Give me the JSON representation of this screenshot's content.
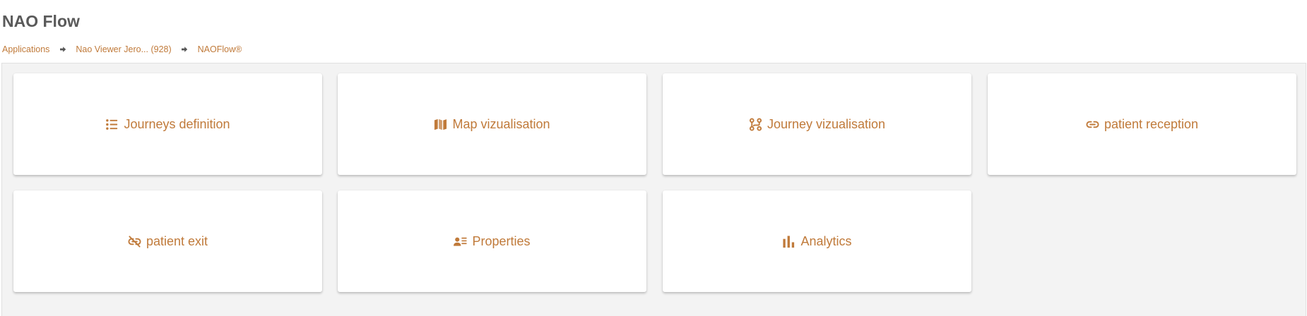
{
  "page": {
    "title": "NAO Flow"
  },
  "breadcrumb": {
    "items": [
      {
        "label": "Applications"
      },
      {
        "label": "Nao Viewer Jero... (928)"
      },
      {
        "label": "NAOFlow®"
      }
    ],
    "separator_icon": "arrow-right-icon"
  },
  "tiles": [
    {
      "label": "Journeys definition",
      "icon": "list-icon"
    },
    {
      "label": "Map vizualisation",
      "icon": "map-icon"
    },
    {
      "label": "Journey vizualisation",
      "icon": "route-icon"
    },
    {
      "label": "patient reception",
      "icon": "link-icon"
    },
    {
      "label": "patient exit",
      "icon": "link-off-icon"
    },
    {
      "label": "Properties",
      "icon": "user-details-icon"
    },
    {
      "label": "Analytics",
      "icon": "bar-chart-icon"
    }
  ],
  "colors": {
    "accent": "#c07a3a",
    "title": "#5a5a5a",
    "background": "#f3f3f3",
    "tile": "#ffffff"
  }
}
